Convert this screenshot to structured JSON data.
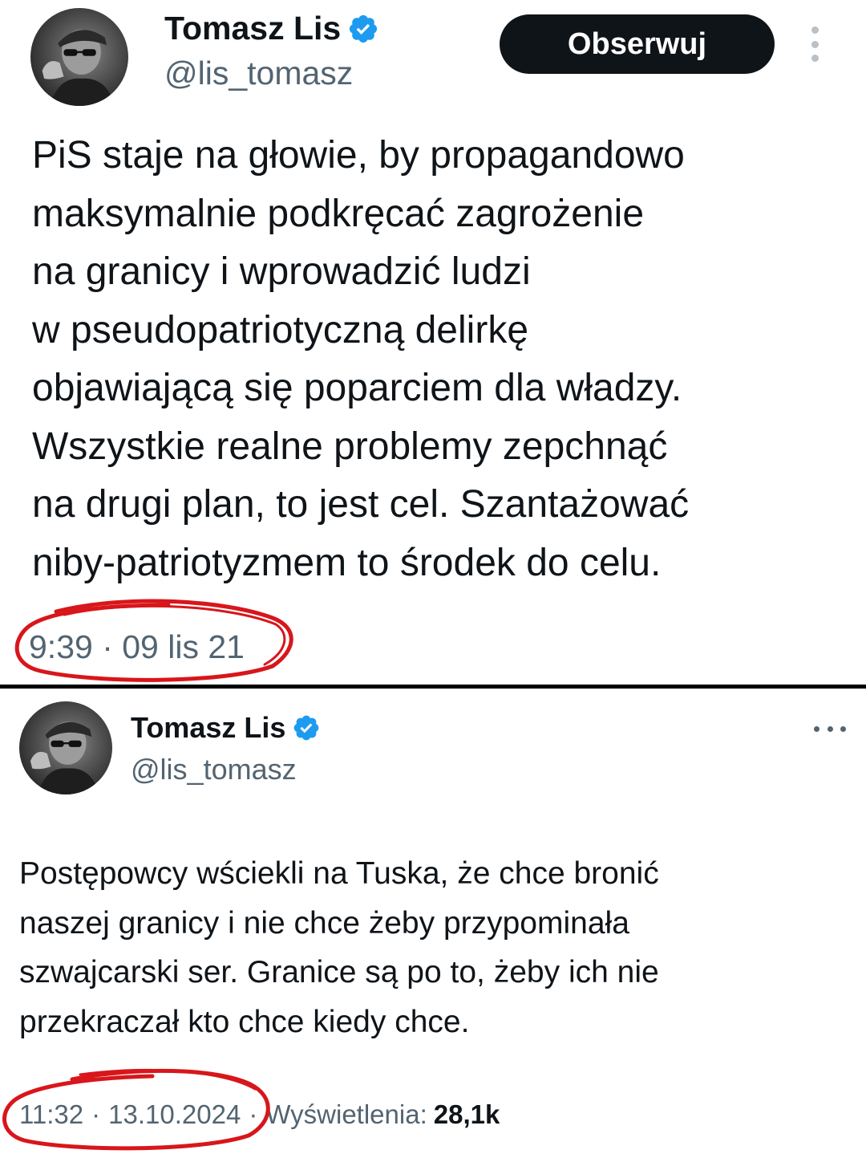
{
  "tweets": [
    {
      "author_name": "Tomasz Lis",
      "handle": "@lis_tomasz",
      "follow_label": "Obserwuj",
      "text_lines": [
        "PiS staje na głowie, by propagandowo",
        "maksymalnie podkręcać zagrożenie",
        "na granicy i wprowadzić ludzi",
        "w pseudopatriotyczną delirkę",
        "objawiającą się  poparciem dla władzy.",
        "Wszystkie realne problemy zepchnąć",
        "na drugi plan, to jest cel. Szantażować",
        "niby-patriotyzmem to środek do celu."
      ],
      "timestamp": "9:39 · 09 lis 21"
    },
    {
      "author_name": "Tomasz Lis",
      "handle": "@lis_tomasz",
      "text_lines": [
        "Postępowcy wściekli na Tuska, że chce bronić",
        "naszej granicy i nie chce żeby przypominała",
        "szwajcarski  ser. Granice są po to, żeby ich nie",
        "przekraczał kto  chce kiedy chce."
      ],
      "time": "11:32",
      "date": "13.10.2024",
      "separator": "·",
      "views_label": "Wyświetlenia:",
      "views_count": "28,1k"
    }
  ],
  "colors": {
    "verified_blue": "#1d9bf0",
    "text_primary": "#0f1419",
    "text_secondary": "#536471",
    "follow_button_bg": "#0f1419",
    "annotation_red": "#d8161b",
    "divider": "#000000"
  },
  "icons": {
    "verified": "verified-badge-icon",
    "more_vertical": "more-vertical-icon",
    "more_horizontal": "more-horizontal-icon"
  }
}
